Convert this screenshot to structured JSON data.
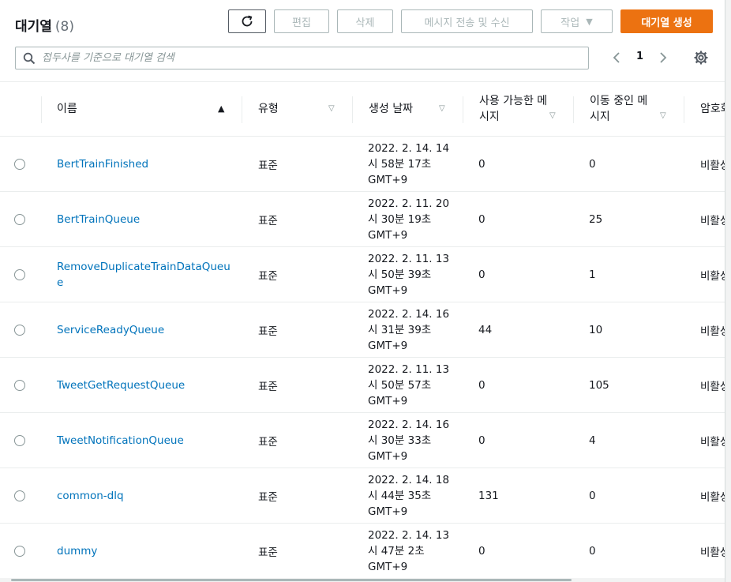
{
  "header": {
    "title": "대기열",
    "count": "(8)",
    "buttons": {
      "edit": "편집",
      "delete": "삭제",
      "send_receive": "메시지 전송 및 수신",
      "actions": "작업",
      "create": "대기열 생성"
    }
  },
  "search": {
    "placeholder": "접두사를 기준으로 대기열 검색",
    "value": ""
  },
  "pagination": {
    "current_page": "1"
  },
  "table": {
    "columns": {
      "name": "이름",
      "type": "유형",
      "created": "생성 날짜",
      "available": "사용 가능한 메시지",
      "in_flight": "이동 중인 메시지",
      "encryption": "암호화"
    },
    "rows": [
      {
        "name": "BertTrainFinished",
        "type": "표준",
        "created": "2022. 2. 14. 14시 58분 17초 GMT+9",
        "available": "0",
        "in_flight": "0",
        "encryption": "비활성"
      },
      {
        "name": "BertTrainQueue",
        "type": "표준",
        "created": "2022. 2. 11. 20시 30분 19초 GMT+9",
        "available": "0",
        "in_flight": "25",
        "encryption": "비활성"
      },
      {
        "name": "RemoveDuplicateTrainDataQueue",
        "type": "표준",
        "created": "2022. 2. 11. 13시 50분 39초 GMT+9",
        "available": "0",
        "in_flight": "1",
        "encryption": "비활성"
      },
      {
        "name": "ServiceReadyQueue",
        "type": "표준",
        "created": "2022. 2. 14. 16시 31분 39초 GMT+9",
        "available": "44",
        "in_flight": "10",
        "encryption": "비활성"
      },
      {
        "name": "TweetGetRequestQueue",
        "type": "표준",
        "created": "2022. 2. 11. 13시 50분 57초 GMT+9",
        "available": "0",
        "in_flight": "105",
        "encryption": "비활성"
      },
      {
        "name": "TweetNotificationQueue",
        "type": "표준",
        "created": "2022. 2. 14. 16시 30분 33초 GMT+9",
        "available": "0",
        "in_flight": "4",
        "encryption": "비활성"
      },
      {
        "name": "common-dlq",
        "type": "표준",
        "created": "2022. 2. 14. 18시 44분 35초 GMT+9",
        "available": "131",
        "in_flight": "0",
        "encryption": "비활성"
      },
      {
        "name": "dummy",
        "type": "표준",
        "created": "2022. 2. 14. 13시 47분 2초 GMT+9",
        "available": "0",
        "in_flight": "0",
        "encryption": "비활성"
      }
    ]
  },
  "colors": {
    "accent": "#ec7211",
    "link": "#0073bb",
    "border": "#aab7b8"
  },
  "icons": {
    "refresh": "refresh-icon",
    "search": "search-icon",
    "prev": "chevron-left-icon",
    "next": "chevron-right-icon",
    "settings": "gear-icon",
    "actions_caret": "caret-down-icon"
  }
}
